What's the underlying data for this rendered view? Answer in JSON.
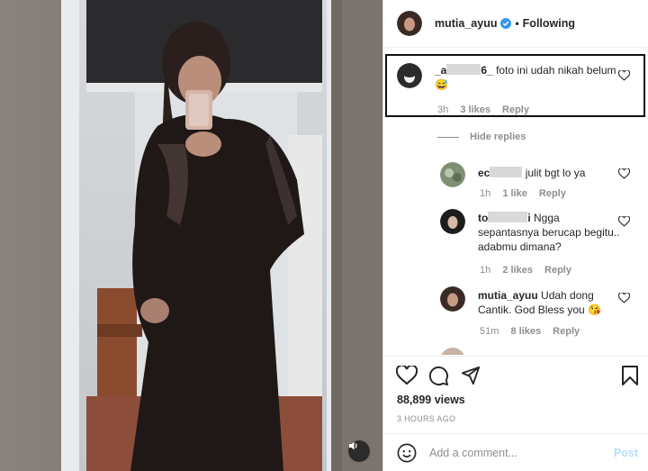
{
  "post": {
    "sound_icon": "speaker-icon"
  },
  "header": {
    "username": "mutia_ayuu",
    "separator": "•",
    "follow_label": "Following"
  },
  "comments": [
    {
      "user_prefix": "_a",
      "user_suffix": "6_",
      "text": "foto ini udah nikah belum",
      "emoji": "😅",
      "time": "3h",
      "likes": "3 likes",
      "reply": "Reply"
    }
  ],
  "hide_replies_label": "Hide replies",
  "replies": [
    {
      "user_prefix": "ec",
      "user_suffix": "",
      "text": "julit bgt lo ya",
      "time": "1h",
      "likes": "1 like",
      "reply": "Reply"
    },
    {
      "user_prefix": "to",
      "user_suffix": "i",
      "text": "Ngga sepantasnya berucap begitu.. adabmu dimana?",
      "time": "1h",
      "likes": "2 likes",
      "reply": "Reply"
    },
    {
      "user_prefix": "mutia_ayuu",
      "user_suffix": "",
      "text": "Udah dong Cantik. God Bless you",
      "emoji": "😘",
      "time": "51m",
      "likes": "8 likes",
      "reply": "Reply"
    }
  ],
  "stats": {
    "views": "88,899 views",
    "posted": "3 HOURS AGO"
  },
  "composer": {
    "placeholder": "Add a comment...",
    "post_label": "Post"
  },
  "colors": {
    "verified": "#3897f0",
    "muted": "#8e8e8e",
    "post_disabled": "#b2dffc"
  }
}
